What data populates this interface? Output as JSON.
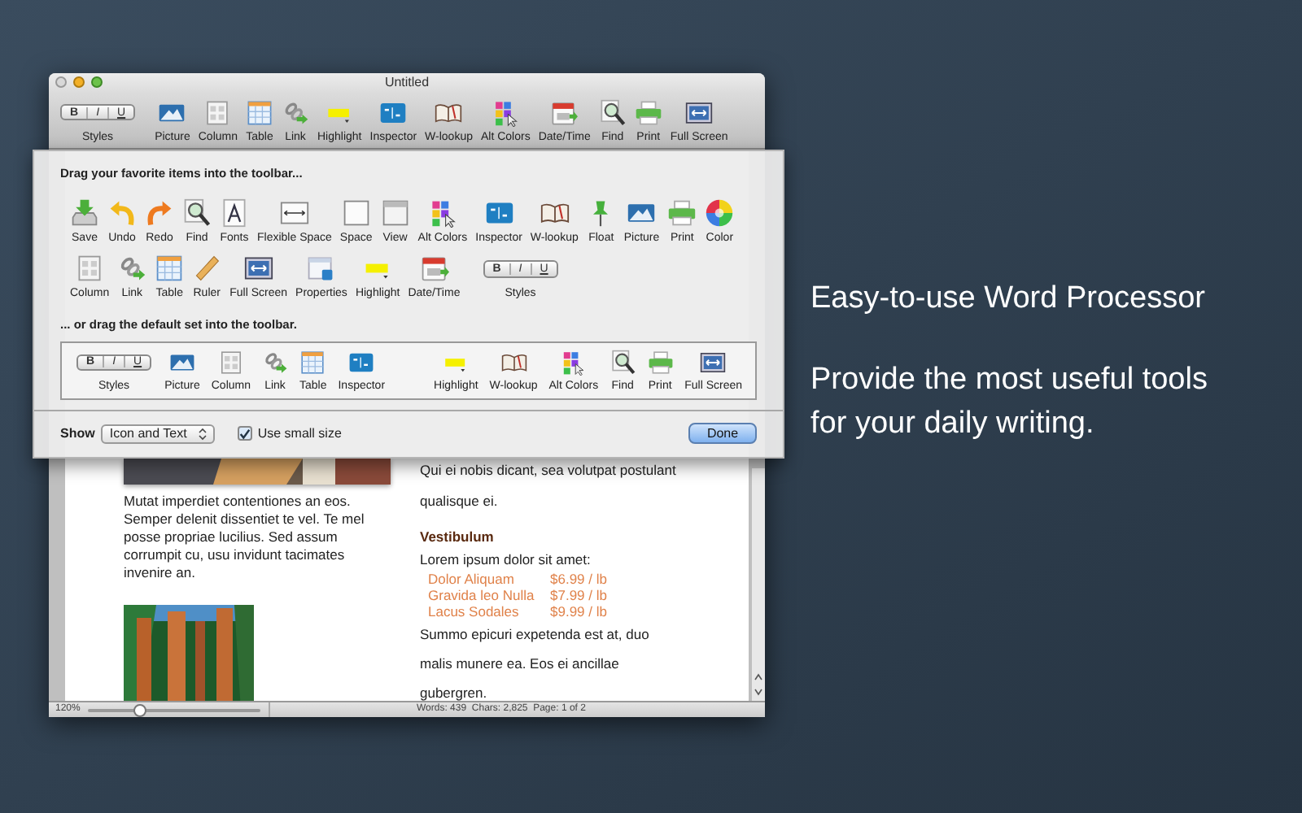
{
  "window": {
    "title": "Untitled"
  },
  "toolbar": {
    "items": [
      {
        "kind": "styles",
        "segments": [
          "B",
          "I",
          "U"
        ],
        "label": "Styles"
      },
      {
        "kind": "tool",
        "label": "Picture"
      },
      {
        "kind": "tool",
        "label": "Column"
      },
      {
        "kind": "tool",
        "label": "Table"
      },
      {
        "kind": "tool",
        "label": "Link"
      },
      {
        "kind": "tool",
        "label": "Highlight"
      },
      {
        "kind": "tool",
        "label": "Inspector"
      },
      {
        "kind": "tool",
        "label": "W-lookup"
      },
      {
        "kind": "tool",
        "label": "Alt Colors"
      },
      {
        "kind": "tool",
        "label": "Date/Time"
      },
      {
        "kind": "tool",
        "label": "Find"
      },
      {
        "kind": "tool",
        "label": "Print"
      },
      {
        "kind": "tool",
        "label": "Full Screen"
      }
    ]
  },
  "customize_sheet": {
    "heading": "Drag your favorite items into the toolbar...",
    "items": [
      {
        "kind": "tool",
        "label": "Save"
      },
      {
        "kind": "tool",
        "label": "Undo"
      },
      {
        "kind": "tool",
        "label": "Redo"
      },
      {
        "kind": "tool",
        "label": "Find"
      },
      {
        "kind": "tool",
        "label": "Fonts"
      },
      {
        "kind": "tool",
        "label": "Flexible Space"
      },
      {
        "kind": "tool",
        "label": "Space"
      },
      {
        "kind": "tool",
        "label": "View"
      },
      {
        "kind": "tool",
        "label": "Alt Colors"
      },
      {
        "kind": "tool",
        "label": "Inspector"
      },
      {
        "kind": "tool",
        "label": "W-lookup"
      },
      {
        "kind": "tool",
        "label": "Float"
      },
      {
        "kind": "tool",
        "label": "Picture"
      },
      {
        "kind": "tool",
        "label": "Print"
      },
      {
        "kind": "tool",
        "label": "Color"
      },
      {
        "kind": "tool",
        "label": "Column"
      },
      {
        "kind": "tool",
        "label": "Link"
      },
      {
        "kind": "tool",
        "label": "Table"
      },
      {
        "kind": "tool",
        "label": "Ruler"
      },
      {
        "kind": "tool",
        "label": "Full Screen"
      },
      {
        "kind": "tool",
        "label": "Properties"
      },
      {
        "kind": "tool",
        "label": "Highlight"
      },
      {
        "kind": "tool",
        "label": "Date/Time"
      },
      {
        "kind": "styles",
        "segments": [
          "B",
          "I",
          "U"
        ],
        "label": "Styles"
      }
    ],
    "default_heading": "... or drag the default set into the toolbar.",
    "default_set": [
      {
        "kind": "styles",
        "segments": [
          "B",
          "I",
          "U"
        ],
        "label": "Styles"
      },
      {
        "kind": "tool",
        "label": "Picture"
      },
      {
        "kind": "tool",
        "label": "Column"
      },
      {
        "kind": "tool",
        "label": "Link"
      },
      {
        "kind": "tool",
        "label": "Table"
      },
      {
        "kind": "tool",
        "label": "Inspector"
      },
      {
        "kind": "flexible_space"
      },
      {
        "kind": "tool",
        "label": "Highlight"
      },
      {
        "kind": "tool",
        "label": "W-lookup"
      },
      {
        "kind": "tool",
        "label": "Alt Colors"
      },
      {
        "kind": "tool",
        "label": "Find"
      },
      {
        "kind": "tool",
        "label": "Print"
      },
      {
        "kind": "tool",
        "label": "Full Screen"
      }
    ],
    "show_label": "Show",
    "show_value": "Icon and Text",
    "small_size": {
      "label": "Use small size",
      "checked": true
    },
    "done_button": "Done"
  },
  "document": {
    "left_paragraph": "Mutat imperdiet contentiones an eos. Semper delenit dissentiet te vel. Te mel posse propriae lucilius. Sed assum corrumpit cu, usu invidunt tacimates invenire an.",
    "right_paragraph_1": "Qui ei nobis dicant, sea volutpat postulant qualisque ei.",
    "heading": "Vestibulum",
    "intro": "Lorem ipsum dolor sit amet:",
    "prices": [
      {
        "name": "Dolor Aliquam",
        "price": "$6.99 / lb"
      },
      {
        "name": "Gravida leo Nulla",
        "price": "$7.99 / lb"
      },
      {
        "name": "Lacus Sodales",
        "price": "$9.99 / lb"
      }
    ],
    "right_paragraph_2": "Summo epicuri expetenda est at, duo malis munere ea. Eos ei ancillae gubergren."
  },
  "status_bar": {
    "zoom": "120%",
    "zoom_slider": {
      "level": 0.3
    },
    "stats": "Words: 439  Chars: 2,825  Page: 1 of 2"
  },
  "promo": {
    "title": "Easy-to-use Word Processor",
    "text": "Provide the most useful tools for your daily writing."
  }
}
